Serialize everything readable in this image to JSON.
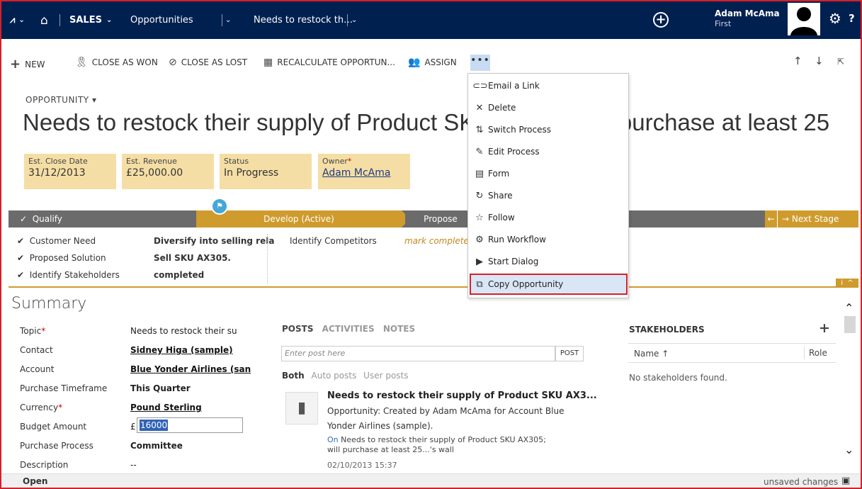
{
  "nav": {
    "logo": "⩘",
    "area": "SALES",
    "entity": "Opportunities",
    "record": "Needs to restock th…",
    "user_name": "Adam McAma",
    "user_org": "First"
  },
  "toolbar": {
    "new": "NEW",
    "close_won": "CLOSE AS WON",
    "close_lost": "CLOSE AS LOST",
    "recalculate": "RECALCULATE OPPORTUN...",
    "assign": "ASSIGN",
    "more": "•••"
  },
  "header": {
    "entity_label": "OPPORTUNITY",
    "title": "Needs to restock their supply of Product SKU AX305; will purchase at least 25",
    "fields": [
      {
        "label": "Est. Close Date",
        "value": "31/12/2013"
      },
      {
        "label": "Est. Revenue",
        "value": "£25,000.00"
      },
      {
        "label": "Status",
        "value": "In Progress"
      },
      {
        "label": "Owner",
        "value": "Adam McAma"
      }
    ]
  },
  "process": {
    "stages": [
      "Qualify",
      "Develop (Active)",
      "Propose"
    ],
    "next_stage": "Next Stage",
    "steps": [
      {
        "name": "Customer Need",
        "value": "Diversify into selling rela"
      },
      {
        "name": "Proposed Solution",
        "value": "Sell SKU AX305."
      },
      {
        "name": "Identify Stakeholders",
        "value": "completed"
      }
    ],
    "competitors_label": "Identify Competitors",
    "competitors_value": "mark complete"
  },
  "summary": {
    "heading": "Summary",
    "fields": [
      {
        "label": "Topic",
        "value": "Needs to restock their su"
      },
      {
        "label": "Contact",
        "value": "Sidney Higa (sample)"
      },
      {
        "label": "Account",
        "value": "Blue Yonder Airlines (san"
      },
      {
        "label": "Purchase Timeframe",
        "value": "This Quarter"
      },
      {
        "label": "Currency",
        "value": "Pound Sterling"
      },
      {
        "label": "Budget Amount",
        "value": "16000",
        "symbol": "£"
      },
      {
        "label": "Purchase Process",
        "value": "Committee"
      },
      {
        "label": "Description",
        "value": "--"
      }
    ]
  },
  "posts": {
    "tabs": [
      "POSTS",
      "ACTIVITIES",
      "NOTES"
    ],
    "placeholder": "Enter post here",
    "post_button": "POST",
    "filters": [
      "Both",
      "Auto posts",
      "User posts"
    ],
    "item": {
      "title": "Needs to restock their supply of Product SKU AX3...",
      "line1": "Opportunity: Created by Adam McAma for Account Blue",
      "line2": "Yonder Airlines (sample).",
      "sub1_link": "On",
      "sub1_text": "Needs to restock their supply of Product SKU AX305;",
      "sub2": "will purchase at least 25...'s wall",
      "date": "02/10/2013 15:37"
    }
  },
  "stakeholders": {
    "heading": "STAKEHOLDERS",
    "col_name": "Name ↑",
    "col_role": "Role",
    "empty": "No stakeholders found."
  },
  "footer": {
    "status": "Open",
    "unsaved": "unsaved changes"
  },
  "menu": {
    "items": [
      {
        "label": "Email a Link",
        "icon": "link-icon"
      },
      {
        "label": "Delete",
        "icon": "x-icon"
      },
      {
        "label": "Switch Process",
        "icon": "switch-icon"
      },
      {
        "label": "Edit Process",
        "icon": "pencil-icon"
      },
      {
        "label": "Form",
        "icon": "form-icon"
      },
      {
        "label": "Share",
        "icon": "share-icon"
      },
      {
        "label": "Follow",
        "icon": "star-icon"
      },
      {
        "label": "Run Workflow",
        "icon": "workflow-icon"
      },
      {
        "label": "Start Dialog",
        "icon": "dialog-icon"
      },
      {
        "label": "Copy Opportunity",
        "icon": "copy-icon"
      }
    ]
  },
  "colors": {
    "nav_bg": "#002050",
    "accent_gold": "#cf9b2d",
    "header_field_bg": "#f5dea5",
    "highlight_border": "#d6202a"
  }
}
